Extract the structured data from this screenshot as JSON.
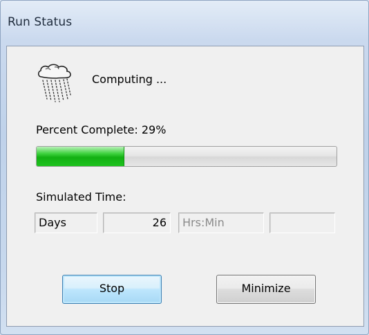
{
  "window": {
    "title": "Run Status"
  },
  "status": {
    "text": "Computing ...",
    "icon": "rain-cloud-icon"
  },
  "progress": {
    "label": "Percent Complete: 29%",
    "percent": 29,
    "bar_color": "#16b516"
  },
  "simulated_time": {
    "label": "Simulated Time:",
    "days_label": "Days",
    "days_value": "26",
    "hrsmin_label": "Hrs:Min",
    "hrsmin_value": ""
  },
  "buttons": {
    "stop": "Stop",
    "minimize": "Minimize"
  }
}
